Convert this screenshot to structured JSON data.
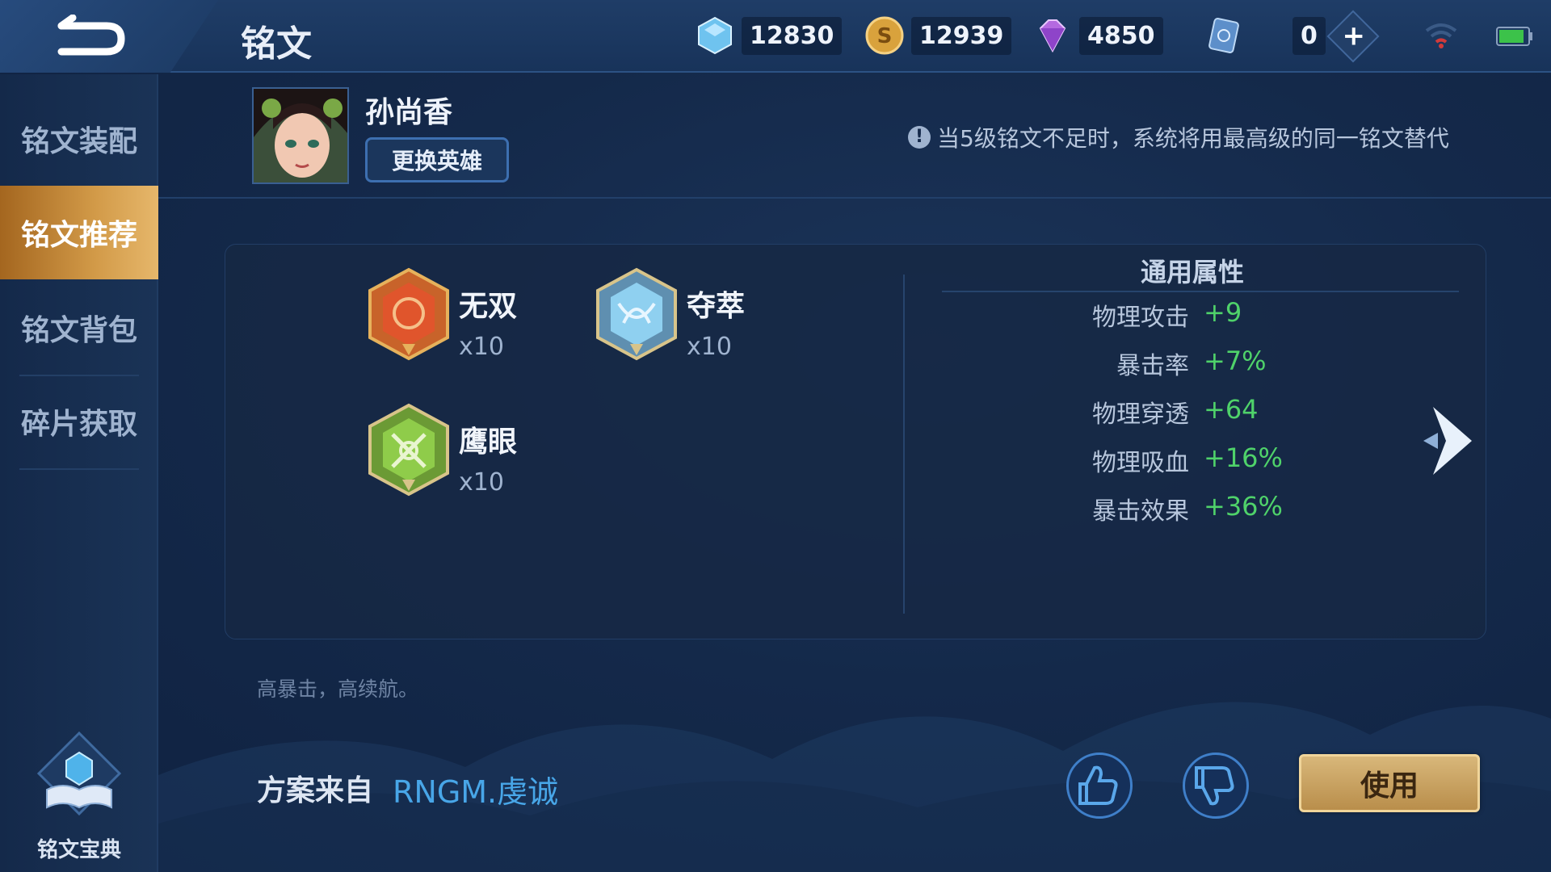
{
  "header": {
    "title": "铭文",
    "currencies": [
      {
        "name": "diamond",
        "value": "12830"
      },
      {
        "name": "gold",
        "value": "12939"
      },
      {
        "name": "gem",
        "value": "4850"
      },
      {
        "name": "card",
        "value": "0"
      }
    ]
  },
  "sidebar": {
    "items": [
      {
        "label": "铭文装配",
        "active": false
      },
      {
        "label": "铭文推荐",
        "active": true
      },
      {
        "label": "铭文背包",
        "active": false
      },
      {
        "label": "碎片获取",
        "active": false
      }
    ],
    "codex_label": "铭文宝典"
  },
  "hero": {
    "name": "孙尚香",
    "change_button": "更换英雄"
  },
  "notice": {
    "icon": "!",
    "text": "当5级铭文不足时，系统将用最高级的同一铭文替代"
  },
  "inscriptions": [
    {
      "name": "无双",
      "count": "x10",
      "color": "#d9542b"
    },
    {
      "name": "夺萃",
      "count": "x10",
      "color": "#6fb3d8"
    },
    {
      "name": "鹰眼",
      "count": "x10",
      "color": "#7cc043"
    }
  ],
  "attributes": {
    "title": "通用属性",
    "rows": [
      {
        "name": "物理攻击",
        "value": "+9"
      },
      {
        "name": "暴击率",
        "value": "+7%"
      },
      {
        "name": "物理穿透",
        "value": "+64"
      },
      {
        "name": "物理吸血",
        "value": "+16%"
      },
      {
        "name": "暴击效果",
        "value": "+36%"
      }
    ]
  },
  "description": "高暴击，高续航。",
  "source": {
    "label": "方案来自",
    "author": "RNGM.虔诚"
  },
  "use_button": "使用",
  "colors": {
    "accent_gold": "#d8b77a",
    "positive_green": "#4fd26a",
    "author_blue": "#48a6e8"
  }
}
